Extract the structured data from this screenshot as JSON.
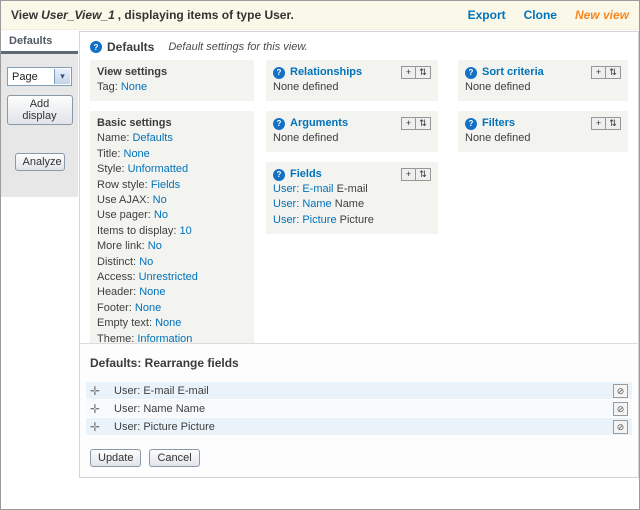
{
  "icons": {
    "help": "?",
    "add": "+",
    "rearrange": "⇅",
    "remove": "⊘",
    "drag": "✛",
    "select_arrow": "▾"
  },
  "topbar": {
    "title_prefix": "View",
    "view_name": "User_View_1",
    "title_suffix": ", displaying items of type User.",
    "links": {
      "export": "Export",
      "clone": "Clone",
      "new_view": "New view"
    }
  },
  "sidebar": {
    "active_tab": "Defaults",
    "display_select": {
      "value": "Page"
    },
    "add_display_label": "Add display",
    "analyze_label": "Analyze"
  },
  "main": {
    "heading": "Defaults",
    "heading_note": "Default settings for this view.",
    "view_settings": {
      "title": "View settings",
      "items": [
        {
          "label": "Tag:",
          "value": "None"
        }
      ]
    },
    "basic_settings": {
      "title": "Basic settings",
      "items": [
        {
          "label": "Name:",
          "value": "Defaults"
        },
        {
          "label": "Title:",
          "value": "None"
        },
        {
          "label": "Style:",
          "value": "Unformatted"
        },
        {
          "label": "Row style:",
          "value": "Fields"
        },
        {
          "label": "Use AJAX:",
          "value": "No"
        },
        {
          "label": "Use pager:",
          "value": "No"
        },
        {
          "label": "Items to display:",
          "value": "10"
        },
        {
          "label": "More link:",
          "value": "No"
        },
        {
          "label": "Distinct:",
          "value": "No"
        },
        {
          "label": "Access:",
          "value": "Unrestricted"
        },
        {
          "label": "Header:",
          "value": "None"
        },
        {
          "label": "Footer:",
          "value": "None"
        },
        {
          "label": "Empty text:",
          "value": "None"
        },
        {
          "label": "Theme:",
          "value": "Information"
        }
      ]
    },
    "relationships": {
      "title": "Relationships",
      "empty": "None defined"
    },
    "arguments": {
      "title": "Arguments",
      "empty": "None defined"
    },
    "fields": {
      "title": "Fields",
      "items": [
        {
          "link": "User: E-mail",
          "suffix": "E-mail"
        },
        {
          "link": "User: Name",
          "suffix": "Name"
        },
        {
          "link": "User: Picture",
          "suffix": "Picture"
        }
      ]
    },
    "sort_criteria": {
      "title": "Sort criteria",
      "empty": "None defined"
    },
    "filters": {
      "title": "Filters",
      "empty": "None defined"
    }
  },
  "rearrange": {
    "title": "Defaults: Rearrange fields",
    "rows": [
      {
        "label": "User: E-mail E-mail"
      },
      {
        "label": "User: Name Name"
      },
      {
        "label": "User: Picture Picture"
      }
    ],
    "update_label": "Update",
    "cancel_label": "Cancel"
  }
}
